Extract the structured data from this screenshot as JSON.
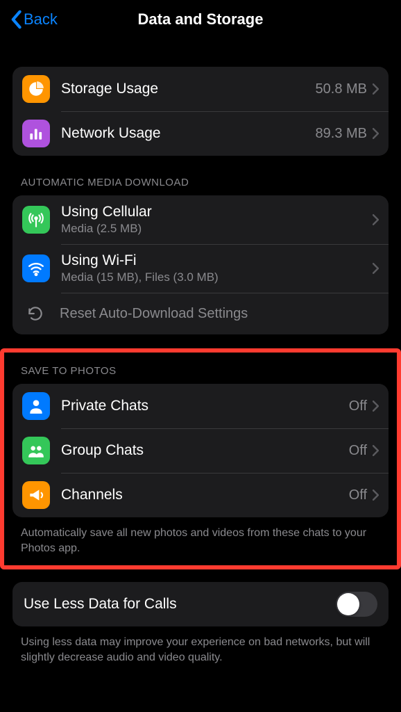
{
  "header": {
    "back_label": "Back",
    "title": "Data and Storage"
  },
  "usage": [
    {
      "label": "Storage Usage",
      "value": "50.8 MB",
      "icon": "pie",
      "color": "orange"
    },
    {
      "label": "Network Usage",
      "value": "89.3 MB",
      "icon": "bars",
      "color": "purple"
    }
  ],
  "auto_download": {
    "header": "AUTOMATIC MEDIA DOWNLOAD",
    "rows": [
      {
        "label": "Using Cellular",
        "sub": "Media (2.5 MB)",
        "icon": "antenna",
        "color": "green"
      },
      {
        "label": "Using Wi-Fi",
        "sub": "Media (15 MB), Files (3.0 MB)",
        "icon": "wifi",
        "color": "blue"
      }
    ],
    "reset_label": "Reset Auto-Download Settings"
  },
  "save_photos": {
    "header": "SAVE TO PHOTOS",
    "rows": [
      {
        "label": "Private Chats",
        "value": "Off",
        "icon": "person",
        "color": "blue"
      },
      {
        "label": "Group Chats",
        "value": "Off",
        "icon": "group",
        "color": "green"
      },
      {
        "label": "Channels",
        "value": "Off",
        "icon": "megaphone",
        "color": "orange"
      }
    ],
    "footer": "Automatically save all new photos and videos from these chats to your Photos app."
  },
  "less_data": {
    "label": "Use Less Data for Calls",
    "on": false,
    "footer": "Using less data may improve your experience on bad networks, but will slightly decrease audio and video quality."
  }
}
